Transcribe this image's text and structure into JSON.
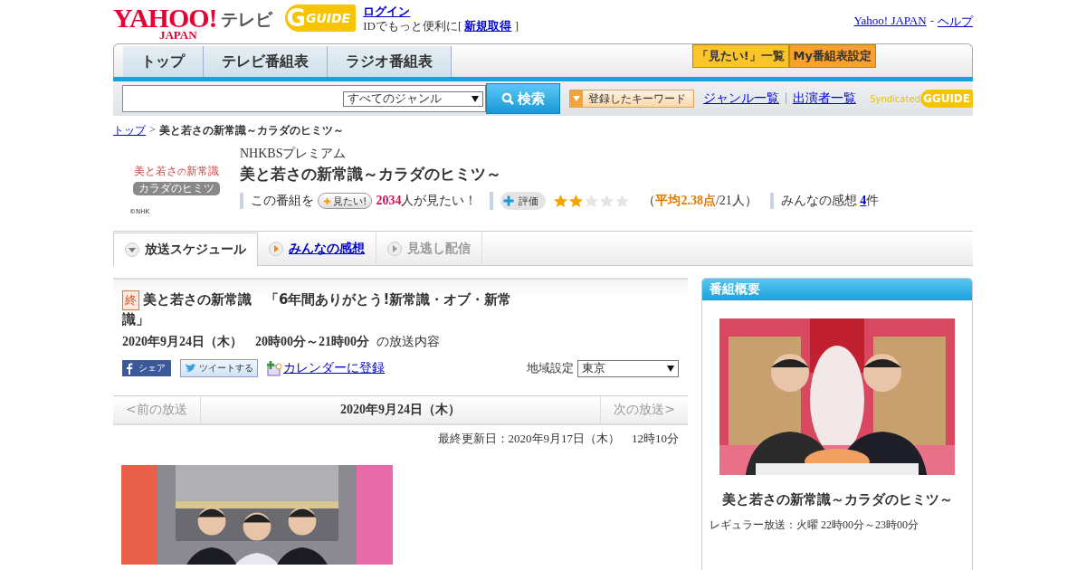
{
  "header": {
    "logo": {
      "brand": "YAHOO!",
      "sub": "JAPAN",
      "service": "テレビ"
    },
    "guide_logo": {
      "mark": "G",
      "text": "GUIDE"
    },
    "login": "ログイン",
    "id_prompt": "IDでもっと便利に[",
    "register": "新規取得",
    "id_prompt_end": "]",
    "top_links": [
      "Yahoo! JAPAN",
      "ヘルプ"
    ],
    "top_links_sep": "-"
  },
  "nav": {
    "tabs": [
      {
        "label": "トップ"
      },
      {
        "label": "テレビ番組表"
      },
      {
        "label": "ラジオ番組表"
      }
    ],
    "buttons": [
      {
        "label": "「見たい!」一覧",
        "color": "#fbc52a"
      },
      {
        "label": "My番組表設定",
        "color": "#f9a12a"
      }
    ]
  },
  "search": {
    "genre": "すべてのジャンル",
    "button": "検索",
    "keyword_button": "登録したキーワード",
    "links": [
      "ジャンル一覧",
      "出演者一覧"
    ],
    "link_sep": "|",
    "syndicated": "Syndicated",
    "guide_mark": "G",
    "guide_text": "GUIDE"
  },
  "breadcrumb": {
    "home": "トップ",
    "sep": ">",
    "current": "美と若さの新常識～カラダのヒミツ～"
  },
  "program": {
    "logo": {
      "title_a": "美と若さ",
      "title_b": "の",
      "title_c": "新常識",
      "subtitle": "カラダのヒミツ",
      "credit": "©NHK"
    },
    "channel": "NHKBSプレミアム",
    "title": "美と若さの新常識～カラダのヒミツ～",
    "want_prefix": "この番組を",
    "want_button": "見たい!",
    "want_count": "2034",
    "want_suffix": "人が見たい！",
    "rate_button": "評価",
    "stars": 2,
    "rating_open": "（",
    "rating_avg": "平均2.38点",
    "rating_count": "/21人）",
    "reviews_label": "みんなの感想",
    "reviews_count": "4",
    "reviews_suffix": "件"
  },
  "sub_tabs": [
    {
      "label": "放送スケジュール",
      "selected": true,
      "disabled": false
    },
    {
      "label": "みんなの感想",
      "selected": false,
      "disabled": false
    },
    {
      "label": "見逃し配信",
      "selected": false,
      "disabled": true
    }
  ],
  "episode": {
    "badge": "終",
    "title": "美と若さの新常識　「6年間ありがとう!新常識・オブ・新常識」",
    "datetime": "2020年9月24日（木）　20時00分～21時00分",
    "datetime_suffix": "の放送内容",
    "share": "シェア",
    "tweet": "ツイートする",
    "calendar": "カレンダーに登録",
    "region_label": "地域設定",
    "region": "東京"
  },
  "pager": {
    "prev": "<前の放送",
    "date": "2020年9月24日（木）",
    "next": "次の放送>"
  },
  "updated": "最終更新日：2020年9月17日（木）　12時10分",
  "sidebar": {
    "header": "番組概要",
    "title": "美と若さの新常識～カラダのヒミツ～",
    "regular": "レギュラー放送：火曜 22時00分～23時00分"
  }
}
